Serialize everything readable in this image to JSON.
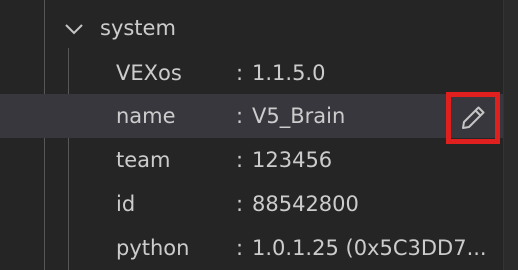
{
  "tree": {
    "section": {
      "label": "system",
      "icon": "chevron-down-icon",
      "expanded": true
    },
    "rows": [
      {
        "key": "VEXos",
        "separator": ":",
        "value": "1.1.5.0"
      },
      {
        "key": "name",
        "separator": ":",
        "value": "V5_Brain",
        "selected": true
      },
      {
        "key": "team",
        "separator": ":",
        "value": "123456"
      },
      {
        "key": "id",
        "separator": ":",
        "value": "88542800"
      },
      {
        "key": "python",
        "separator": ":",
        "value": "1.0.1.25 (0x5C3DD7..."
      }
    ],
    "edit_icon": "pencil-icon",
    "colors": {
      "background": "#252526",
      "selected_row": "#37373d",
      "text": "#cccccc",
      "highlight_box": "#e01f1f"
    }
  }
}
